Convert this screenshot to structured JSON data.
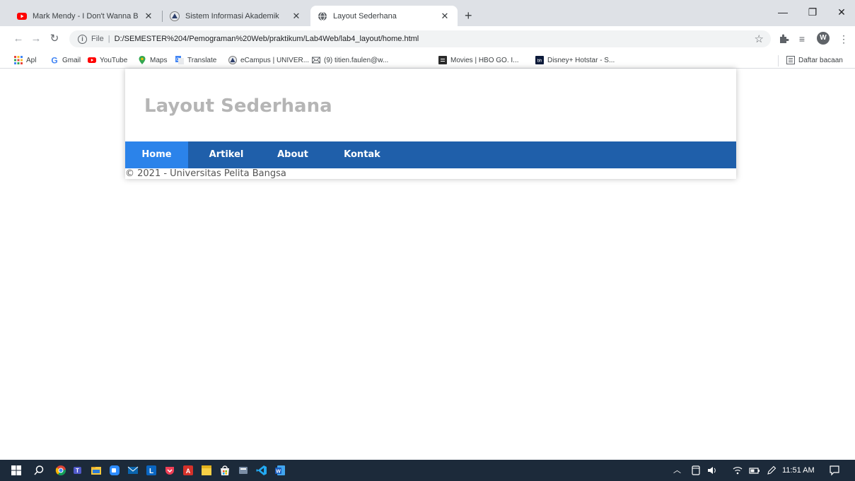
{
  "browser": {
    "tabs": [
      {
        "title": "Mark Mendy - I Don't Wanna Be",
        "active": false
      },
      {
        "title": "Sistem Informasi Akademik",
        "active": false
      },
      {
        "title": "Layout Sederhana",
        "active": true
      }
    ],
    "new_tab_label": "+",
    "window_controls": {
      "minimize": "—",
      "restore": "❐",
      "close": "✕"
    },
    "address": {
      "file_label": "File",
      "separator": "|",
      "url": "D:/SEMESTER%204/Pemograman%20Web/praktikum/Lab4Web/lab4_layout/home.html"
    },
    "profile_initial": "W",
    "bookmarks": [
      {
        "label": "Apl",
        "icon": "apps-grid-icon"
      },
      {
        "label": "Gmail",
        "icon": "google-icon"
      },
      {
        "label": "YouTube",
        "icon": "youtube-icon"
      },
      {
        "label": "Maps",
        "icon": "maps-pin-icon"
      },
      {
        "label": "Translate",
        "icon": "translate-icon"
      },
      {
        "label": "eCampus | UNIVER...",
        "icon": "ecampus-icon"
      },
      {
        "label": "(9) titien.faulen@w...",
        "icon": "mail-icon"
      },
      {
        "label": "Movies | HBO GO. I...",
        "icon": "hbo-icon"
      },
      {
        "label": "Disney+ Hotstar - S...",
        "icon": "hotstar-icon"
      }
    ],
    "reading_list": "Daftar bacaan"
  },
  "page": {
    "title": "Layout Sederhana",
    "nav": [
      "Home",
      "Artikel",
      "About",
      "Kontak"
    ],
    "footer": "© 2021 - Universitas Pelita Bangsa"
  },
  "taskbar": {
    "clock": "11:51 AM"
  },
  "colors": {
    "nav_bar": "#1f5faa",
    "nav_active": "#2b83ea",
    "title_gray": "#b5b5b5",
    "tabstrip": "#dee1e6",
    "taskbar": "#1c2a3a"
  }
}
